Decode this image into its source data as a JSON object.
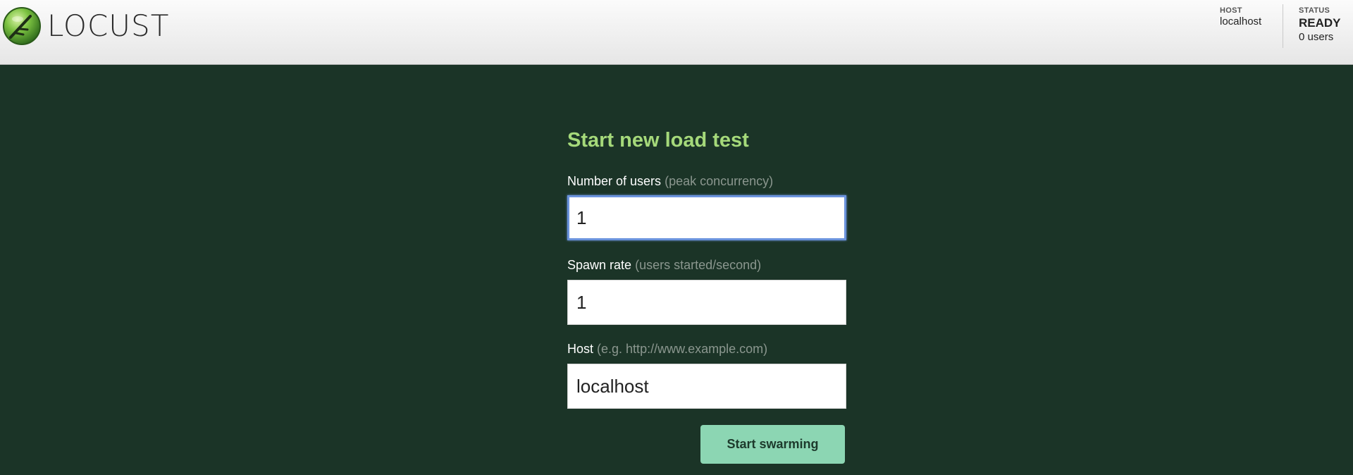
{
  "app": {
    "logo_text": "LOCUST",
    "icon": "locust-logo-icon"
  },
  "header": {
    "host_label": "HOST",
    "host_value": "localhost",
    "status_label": "STATUS",
    "status_value": "READY",
    "users_count": "0 users"
  },
  "form": {
    "title": "Start new load test",
    "users": {
      "label": "Number of users",
      "hint": "(peak concurrency)",
      "value": "1"
    },
    "spawn_rate": {
      "label": "Spawn rate",
      "hint": "(users started/second)",
      "value": "1"
    },
    "host": {
      "label": "Host",
      "hint": "(e.g. http://www.example.com)",
      "value": "localhost"
    },
    "submit_label": "Start swarming"
  },
  "colors": {
    "background": "#1b3427",
    "title": "#a5d97a",
    "button": "#8cd6b3",
    "focus_ring": "#6b93dd"
  }
}
